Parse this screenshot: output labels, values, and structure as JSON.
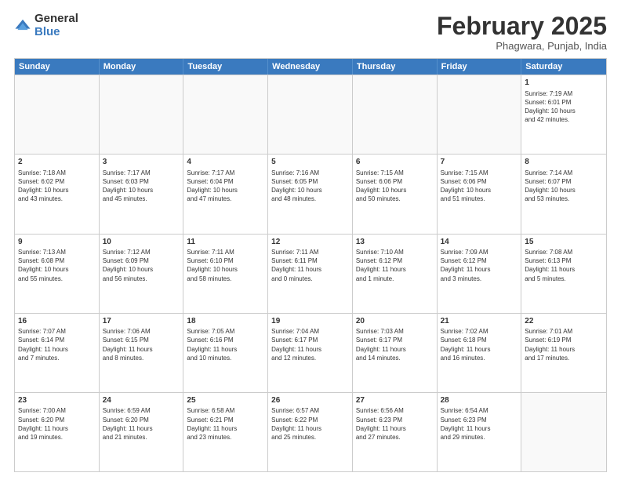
{
  "logo": {
    "general": "General",
    "blue": "Blue"
  },
  "title": "February 2025",
  "location": "Phagwara, Punjab, India",
  "days": [
    "Sunday",
    "Monday",
    "Tuesday",
    "Wednesday",
    "Thursday",
    "Friday",
    "Saturday"
  ],
  "weeks": [
    [
      {
        "day": "",
        "info": ""
      },
      {
        "day": "",
        "info": ""
      },
      {
        "day": "",
        "info": ""
      },
      {
        "day": "",
        "info": ""
      },
      {
        "day": "",
        "info": ""
      },
      {
        "day": "",
        "info": ""
      },
      {
        "day": "1",
        "info": "Sunrise: 7:19 AM\nSunset: 6:01 PM\nDaylight: 10 hours\nand 42 minutes."
      }
    ],
    [
      {
        "day": "2",
        "info": "Sunrise: 7:18 AM\nSunset: 6:02 PM\nDaylight: 10 hours\nand 43 minutes."
      },
      {
        "day": "3",
        "info": "Sunrise: 7:17 AM\nSunset: 6:03 PM\nDaylight: 10 hours\nand 45 minutes."
      },
      {
        "day": "4",
        "info": "Sunrise: 7:17 AM\nSunset: 6:04 PM\nDaylight: 10 hours\nand 47 minutes."
      },
      {
        "day": "5",
        "info": "Sunrise: 7:16 AM\nSunset: 6:05 PM\nDaylight: 10 hours\nand 48 minutes."
      },
      {
        "day": "6",
        "info": "Sunrise: 7:15 AM\nSunset: 6:06 PM\nDaylight: 10 hours\nand 50 minutes."
      },
      {
        "day": "7",
        "info": "Sunrise: 7:15 AM\nSunset: 6:06 PM\nDaylight: 10 hours\nand 51 minutes."
      },
      {
        "day": "8",
        "info": "Sunrise: 7:14 AM\nSunset: 6:07 PM\nDaylight: 10 hours\nand 53 minutes."
      }
    ],
    [
      {
        "day": "9",
        "info": "Sunrise: 7:13 AM\nSunset: 6:08 PM\nDaylight: 10 hours\nand 55 minutes."
      },
      {
        "day": "10",
        "info": "Sunrise: 7:12 AM\nSunset: 6:09 PM\nDaylight: 10 hours\nand 56 minutes."
      },
      {
        "day": "11",
        "info": "Sunrise: 7:11 AM\nSunset: 6:10 PM\nDaylight: 10 hours\nand 58 minutes."
      },
      {
        "day": "12",
        "info": "Sunrise: 7:11 AM\nSunset: 6:11 PM\nDaylight: 11 hours\nand 0 minutes."
      },
      {
        "day": "13",
        "info": "Sunrise: 7:10 AM\nSunset: 6:12 PM\nDaylight: 11 hours\nand 1 minute."
      },
      {
        "day": "14",
        "info": "Sunrise: 7:09 AM\nSunset: 6:12 PM\nDaylight: 11 hours\nand 3 minutes."
      },
      {
        "day": "15",
        "info": "Sunrise: 7:08 AM\nSunset: 6:13 PM\nDaylight: 11 hours\nand 5 minutes."
      }
    ],
    [
      {
        "day": "16",
        "info": "Sunrise: 7:07 AM\nSunset: 6:14 PM\nDaylight: 11 hours\nand 7 minutes."
      },
      {
        "day": "17",
        "info": "Sunrise: 7:06 AM\nSunset: 6:15 PM\nDaylight: 11 hours\nand 8 minutes."
      },
      {
        "day": "18",
        "info": "Sunrise: 7:05 AM\nSunset: 6:16 PM\nDaylight: 11 hours\nand 10 minutes."
      },
      {
        "day": "19",
        "info": "Sunrise: 7:04 AM\nSunset: 6:17 PM\nDaylight: 11 hours\nand 12 minutes."
      },
      {
        "day": "20",
        "info": "Sunrise: 7:03 AM\nSunset: 6:17 PM\nDaylight: 11 hours\nand 14 minutes."
      },
      {
        "day": "21",
        "info": "Sunrise: 7:02 AM\nSunset: 6:18 PM\nDaylight: 11 hours\nand 16 minutes."
      },
      {
        "day": "22",
        "info": "Sunrise: 7:01 AM\nSunset: 6:19 PM\nDaylight: 11 hours\nand 17 minutes."
      }
    ],
    [
      {
        "day": "23",
        "info": "Sunrise: 7:00 AM\nSunset: 6:20 PM\nDaylight: 11 hours\nand 19 minutes."
      },
      {
        "day": "24",
        "info": "Sunrise: 6:59 AM\nSunset: 6:20 PM\nDaylight: 11 hours\nand 21 minutes."
      },
      {
        "day": "25",
        "info": "Sunrise: 6:58 AM\nSunset: 6:21 PM\nDaylight: 11 hours\nand 23 minutes."
      },
      {
        "day": "26",
        "info": "Sunrise: 6:57 AM\nSunset: 6:22 PM\nDaylight: 11 hours\nand 25 minutes."
      },
      {
        "day": "27",
        "info": "Sunrise: 6:56 AM\nSunset: 6:23 PM\nDaylight: 11 hours\nand 27 minutes."
      },
      {
        "day": "28",
        "info": "Sunrise: 6:54 AM\nSunset: 6:23 PM\nDaylight: 11 hours\nand 29 minutes."
      },
      {
        "day": "",
        "info": ""
      }
    ]
  ]
}
